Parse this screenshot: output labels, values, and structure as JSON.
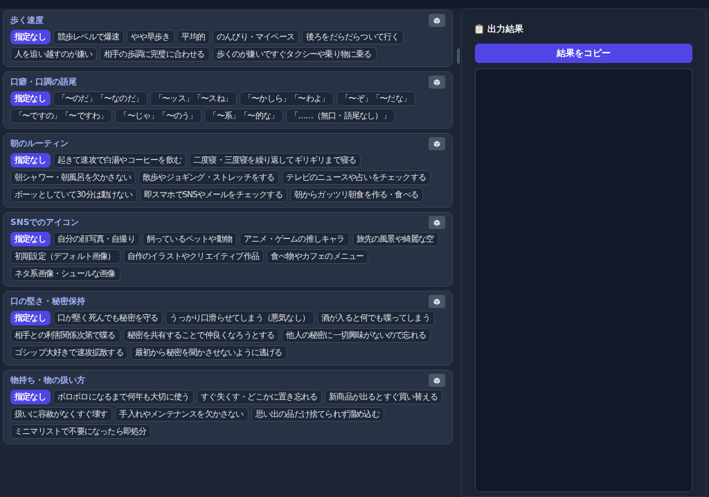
{
  "sections": [
    {
      "title": "歩く速度",
      "options": [
        {
          "label": "指定なし",
          "selected": true
        },
        {
          "label": "競歩レベルで爆速",
          "selected": false
        },
        {
          "label": "やや早歩き",
          "selected": false
        },
        {
          "label": "平均的",
          "selected": false
        },
        {
          "label": "のんびり・マイペース",
          "selected": false
        },
        {
          "label": "後ろをだらだらついて行く",
          "selected": false
        },
        {
          "label": "人を追い越すのが嫌い",
          "selected": false
        },
        {
          "label": "相手の歩調に完璧に合わせる",
          "selected": false
        },
        {
          "label": "歩くのが嫌いですぐタクシーや乗り物に乗る",
          "selected": false
        }
      ]
    },
    {
      "title": "口癖・口調の語尾",
      "options": [
        {
          "label": "指定なし",
          "selected": true
        },
        {
          "label": "「〜のだ」「〜なのだ」",
          "selected": false
        },
        {
          "label": "「〜ッス」「〜スね」",
          "selected": false
        },
        {
          "label": "「〜かしら」「〜わよ」",
          "selected": false
        },
        {
          "label": "「〜ぞ」「〜だな」",
          "selected": false
        },
        {
          "label": "「〜ですの」「〜ですわ」",
          "selected": false
        },
        {
          "label": "「〜じゃ」「〜のう」",
          "selected": false
        },
        {
          "label": "「〜系」「〜的な」",
          "selected": false
        },
        {
          "label": "「……（無口・語尾なし）」",
          "selected": false
        }
      ]
    },
    {
      "title": "朝のルーティン",
      "options": [
        {
          "label": "指定なし",
          "selected": true
        },
        {
          "label": "起きて速攻で白湯やコーヒーを飲む",
          "selected": false
        },
        {
          "label": "二度寝・三度寝を繰り返してギリギリまで寝る",
          "selected": false
        },
        {
          "label": "朝シャワー・朝風呂を欠かさない",
          "selected": false
        },
        {
          "label": "散歩やジョギング・ストレッチをする",
          "selected": false
        },
        {
          "label": "テレビのニュースや占いをチェックする",
          "selected": false
        },
        {
          "label": "ボーッとしていて30分は動けない",
          "selected": false
        },
        {
          "label": "即スマホでSNSやメールをチェックする",
          "selected": false
        },
        {
          "label": "朝からガッツリ朝食を作る・食べる",
          "selected": false
        }
      ]
    },
    {
      "title": "SNSでのアイコン",
      "options": [
        {
          "label": "指定なし",
          "selected": true
        },
        {
          "label": "自分の顔写真・自撮り",
          "selected": false
        },
        {
          "label": "飼っているペットや動物",
          "selected": false
        },
        {
          "label": "アニメ・ゲームの推しキャラ",
          "selected": false
        },
        {
          "label": "旅先の風景や綺麗な空",
          "selected": false
        },
        {
          "label": "初期設定（デフォルト画像）",
          "selected": false
        },
        {
          "label": "自作のイラストやクリエイティブ作品",
          "selected": false
        },
        {
          "label": "食べ物やカフェのメニュー",
          "selected": false
        },
        {
          "label": "ネタ系画像・シュールな画像",
          "selected": false
        }
      ]
    },
    {
      "title": "口の堅さ・秘密保持",
      "options": [
        {
          "label": "指定なし",
          "selected": true
        },
        {
          "label": "口が堅く死んでも秘密を守る",
          "selected": false
        },
        {
          "label": "うっかり口滑らせてしまう（悪気なし）",
          "selected": false
        },
        {
          "label": "酒が入ると何でも喋ってしまう",
          "selected": false
        },
        {
          "label": "相手との利害関係次第で喋る",
          "selected": false
        },
        {
          "label": "秘密を共有することで仲良くなろうとする",
          "selected": false
        },
        {
          "label": "他人の秘密に一切興味がないので忘れる",
          "selected": false
        },
        {
          "label": "ゴシップ大好きで速攻拡散する",
          "selected": false
        },
        {
          "label": "最初から秘密を聞かさせないように逃げる",
          "selected": false
        }
      ]
    },
    {
      "title": "物持ち・物の扱い方",
      "options": [
        {
          "label": "指定なし",
          "selected": true
        },
        {
          "label": "ボロボロになるまで何年も大切に使う",
          "selected": false
        },
        {
          "label": "すぐ失くす・どこかに置き忘れる",
          "selected": false
        },
        {
          "label": "新商品が出るとすぐ買い替える",
          "selected": false
        },
        {
          "label": "扱いに容赦がなくすぐ壊す",
          "selected": false
        },
        {
          "label": "手入れやメンテナンスを欠かさない",
          "selected": false
        },
        {
          "label": "思い出の品だけ捨てられず溜め込む",
          "selected": false
        },
        {
          "label": "ミニマリストで不要になったら即処分",
          "selected": false
        }
      ]
    }
  ],
  "output": {
    "title": "出力結果",
    "copy_button": "結果をコピー"
  }
}
